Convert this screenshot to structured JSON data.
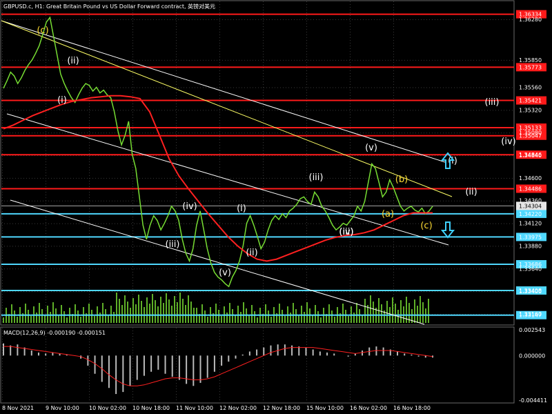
{
  "header": {
    "title": "GBPUSD.c, H1:  Great Britain Pound vs US Dollar Forward contract, 英镑对美元"
  },
  "colors": {
    "background": "#000000",
    "grid": "#3a3a3a",
    "price_line": "#77dd33",
    "ma_line": "#ff2020",
    "red_level": "#ff1a1a",
    "cyan_level": "#4fd8ff",
    "white_channel": "#ffffff",
    "yellow_channel": "#ffff66",
    "wave_white": "#ffffff",
    "wave_yellow": "#ffdd33",
    "arrow_cyan": "#3fd0ff",
    "macd_hist": "#bbbbbb",
    "macd_signal": "#ff2020"
  },
  "chart_data": [
    {
      "type": "line",
      "title": "GBPUSD.c, H1:  Great Britain Pound vs US Dollar Forward contract, 英镑对美元",
      "x_ticks": [
        "8 Nov 2021",
        "9 Nov 10:00",
        "10 Nov 02:00",
        "10 Nov 18:00",
        "11 Nov 10:00",
        "12 Nov 02:00",
        "12 Nov 18:00",
        "15 Nov 10:00",
        "16 Nov 02:00",
        "16 Nov 18:00"
      ],
      "y_ticks": [
        "1.36280",
        "1.35850",
        "1.35560",
        "1.35320",
        "1.35080",
        "1.34840",
        "1.34600",
        "1.34360",
        "1.34120",
        "1.33880",
        "1.33640",
        "1.33400",
        "1.33160"
      ],
      "ylim": [
        1.3305,
        1.3647
      ],
      "current_price": "1.34304",
      "red_levels": [
        "1.36334",
        "1.35047",
        "1.35773",
        "1.35421",
        "1.35133",
        "1.34846",
        "1.34486"
      ],
      "cyan_levels": [
        "1.34220",
        "1.33975",
        "1.33686",
        "1.33408",
        "1.33147"
      ],
      "series": [
        {
          "values": [
            1.3555,
            1.3563,
            1.3572,
            1.3568,
            1.356,
            1.3566,
            1.3574,
            1.358,
            1.3585,
            1.3592,
            1.36,
            1.3612,
            1.3625,
            1.363,
            1.361,
            1.359,
            1.357,
            1.356,
            1.3552,
            1.3545,
            1.354,
            1.3548,
            1.3555,
            1.356,
            1.3558,
            1.3552,
            1.3556,
            1.355,
            1.3553,
            1.3548,
            1.3545,
            1.353,
            1.351,
            1.3495,
            1.3505,
            1.352,
            1.3485,
            1.347,
            1.344,
            1.341,
            1.3395,
            1.341,
            1.342,
            1.3415,
            1.3405,
            1.3412,
            1.342,
            1.343,
            1.3425,
            1.3415,
            1.3395,
            1.338,
            1.3372,
            1.3385,
            1.341,
            1.3425,
            1.3405,
            1.3385,
            1.337,
            1.336,
            1.3355,
            1.3352,
            1.3348,
            1.3345,
            1.3355,
            1.3362,
            1.3372,
            1.3388,
            1.3412,
            1.342,
            1.341,
            1.3398,
            1.3385,
            1.3392,
            1.3405,
            1.3415,
            1.342,
            1.3416,
            1.3422,
            1.3418,
            1.3425,
            1.3428,
            1.3432,
            1.3438,
            1.344,
            1.3435,
            1.3432,
            1.3445,
            1.344,
            1.343,
            1.3425,
            1.3418,
            1.341,
            1.3405,
            1.3408,
            1.3412,
            1.341,
            1.3415,
            1.342,
            1.343,
            1.3425,
            1.3435,
            1.3455,
            1.3475,
            1.347,
            1.3455,
            1.344,
            1.3445,
            1.3458,
            1.345,
            1.344,
            1.343,
            1.3425,
            1.3428,
            1.343,
            1.3426,
            1.3424,
            1.3428,
            1.3422,
            1.3425,
            1.343
          ]
        },
        {
          "values": [
            1.3512,
            1.3516,
            1.3521,
            1.3526,
            1.353,
            1.3534,
            1.3538,
            1.3541,
            1.3543,
            1.3545,
            1.3546,
            1.3547,
            1.3547,
            1.3546,
            1.3544,
            1.353,
            1.3505,
            1.348,
            1.3462,
            1.3448,
            1.3435,
            1.3422,
            1.341,
            1.3398,
            1.3388,
            1.338,
            1.3374,
            1.3372,
            1.3374,
            1.3378,
            1.3382,
            1.3386,
            1.339,
            1.3394,
            1.3397,
            1.3399,
            1.34,
            1.3402,
            1.3405,
            1.341,
            1.3415,
            1.342,
            1.3423,
            1.3423,
            1.3423
          ]
        }
      ],
      "macd": {
        "label": "MACD(12,26,9) -0.000190 -0.000151",
        "y_ticks": [
          "0.002543",
          "0.000000",
          "-0.004411"
        ],
        "ylim": [
          -0.004411,
          0.002543
        ],
        "histogram": [
          0.0012,
          0.001,
          0.0011,
          0.0008,
          0.0005,
          0.0003,
          0.0002,
          0.0003,
          0.0002,
          0.0001,
          0.0,
          -0.0003,
          -0.001,
          -0.0018,
          -0.0026,
          -0.0032,
          -0.0038,
          -0.0036,
          -0.003,
          -0.0024,
          -0.002,
          -0.0016,
          -0.0014,
          -0.0018,
          -0.0021,
          -0.0024,
          -0.0028,
          -0.003,
          -0.0027,
          -0.0022,
          -0.0016,
          -0.001,
          -0.0006,
          -0.0003,
          0.0001,
          0.0004,
          0.0006,
          0.0008,
          0.001,
          0.0011,
          0.0011,
          0.001,
          0.0009,
          0.0008,
          0.0006,
          0.0004,
          0.0003,
          0.0002,
          0.0,
          -0.0001,
          0.0002,
          0.0005,
          0.0008,
          0.0009,
          0.0008,
          0.0006,
          0.0004,
          0.0002,
          0.0001,
          -0.0001,
          -0.0002,
          -0.0002
        ],
        "signal": [
          0.0009,
          0.0009,
          0.0008,
          0.0007,
          0.0006,
          0.0005,
          0.0004,
          0.0003,
          0.0002,
          0.0001,
          0.0,
          -0.0001,
          -0.0004,
          -0.0008,
          -0.0013,
          -0.0019,
          -0.0024,
          -0.0028,
          -0.003,
          -0.003,
          -0.0029,
          -0.0027,
          -0.0025,
          -0.0023,
          -0.0022,
          -0.0022,
          -0.0023,
          -0.0024,
          -0.0024,
          -0.0023,
          -0.0021,
          -0.0018,
          -0.0015,
          -0.0012,
          -0.0009,
          -0.0006,
          -0.0003,
          0.0,
          0.0003,
          0.0005,
          0.0007,
          0.0008,
          0.0008,
          0.0008,
          0.0008,
          0.0007,
          0.0006,
          0.0005,
          0.0004,
          0.0003,
          0.0002,
          0.0003,
          0.0004,
          0.0005,
          0.0005,
          0.0005,
          0.0004,
          0.0003,
          0.0002,
          0.0001,
          0.0,
          -0.0001
        ]
      }
    }
  ],
  "wave_labels": [
    {
      "text": "(c)",
      "color": "yellow"
    },
    {
      "text": "(ii)",
      "color": "white"
    },
    {
      "text": "(i)",
      "color": "white"
    },
    {
      "text": "(iii)",
      "color": "white"
    },
    {
      "text": "(iv)",
      "color": "white"
    },
    {
      "text": "(iii)",
      "color": "white"
    },
    {
      "text": "(v)",
      "color": "white"
    },
    {
      "text": "(i)",
      "color": "white"
    },
    {
      "text": "(ii)",
      "color": "white"
    },
    {
      "text": "(iii)",
      "color": "white"
    },
    {
      "text": "(iv)",
      "color": "white"
    },
    {
      "text": "(v)",
      "color": "white"
    },
    {
      "text": "(a)",
      "color": "yellow"
    },
    {
      "text": "(b)",
      "color": "yellow"
    },
    {
      "text": "(c)",
      "color": "yellow"
    },
    {
      "text": "(i)",
      "color": "white"
    },
    {
      "text": "(ii)",
      "color": "white"
    },
    {
      "text": "(iii)",
      "color": "white"
    },
    {
      "text": "(iv)",
      "color": "white"
    }
  ],
  "arrows": [
    {
      "name": "up-arrow-icon",
      "direction": "up"
    },
    {
      "name": "down-arrow-icon",
      "direction": "down"
    }
  ]
}
